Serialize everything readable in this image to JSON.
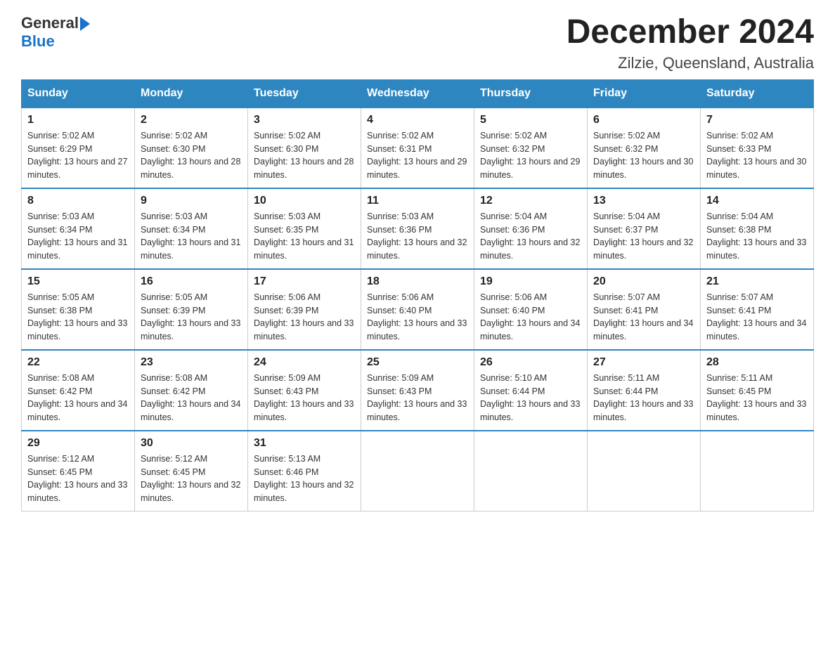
{
  "logo": {
    "general": "General",
    "blue": "Blue"
  },
  "title": "December 2024",
  "location": "Zilzie, Queensland, Australia",
  "days_of_week": [
    "Sunday",
    "Monday",
    "Tuesday",
    "Wednesday",
    "Thursday",
    "Friday",
    "Saturday"
  ],
  "weeks": [
    [
      {
        "day": "1",
        "sunrise": "5:02 AM",
        "sunset": "6:29 PM",
        "daylight": "13 hours and 27 minutes."
      },
      {
        "day": "2",
        "sunrise": "5:02 AM",
        "sunset": "6:30 PM",
        "daylight": "13 hours and 28 minutes."
      },
      {
        "day": "3",
        "sunrise": "5:02 AM",
        "sunset": "6:30 PM",
        "daylight": "13 hours and 28 minutes."
      },
      {
        "day": "4",
        "sunrise": "5:02 AM",
        "sunset": "6:31 PM",
        "daylight": "13 hours and 29 minutes."
      },
      {
        "day": "5",
        "sunrise": "5:02 AM",
        "sunset": "6:32 PM",
        "daylight": "13 hours and 29 minutes."
      },
      {
        "day": "6",
        "sunrise": "5:02 AM",
        "sunset": "6:32 PM",
        "daylight": "13 hours and 30 minutes."
      },
      {
        "day": "7",
        "sunrise": "5:02 AM",
        "sunset": "6:33 PM",
        "daylight": "13 hours and 30 minutes."
      }
    ],
    [
      {
        "day": "8",
        "sunrise": "5:03 AM",
        "sunset": "6:34 PM",
        "daylight": "13 hours and 31 minutes."
      },
      {
        "day": "9",
        "sunrise": "5:03 AM",
        "sunset": "6:34 PM",
        "daylight": "13 hours and 31 minutes."
      },
      {
        "day": "10",
        "sunrise": "5:03 AM",
        "sunset": "6:35 PM",
        "daylight": "13 hours and 31 minutes."
      },
      {
        "day": "11",
        "sunrise": "5:03 AM",
        "sunset": "6:36 PM",
        "daylight": "13 hours and 32 minutes."
      },
      {
        "day": "12",
        "sunrise": "5:04 AM",
        "sunset": "6:36 PM",
        "daylight": "13 hours and 32 minutes."
      },
      {
        "day": "13",
        "sunrise": "5:04 AM",
        "sunset": "6:37 PM",
        "daylight": "13 hours and 32 minutes."
      },
      {
        "day": "14",
        "sunrise": "5:04 AM",
        "sunset": "6:38 PM",
        "daylight": "13 hours and 33 minutes."
      }
    ],
    [
      {
        "day": "15",
        "sunrise": "5:05 AM",
        "sunset": "6:38 PM",
        "daylight": "13 hours and 33 minutes."
      },
      {
        "day": "16",
        "sunrise": "5:05 AM",
        "sunset": "6:39 PM",
        "daylight": "13 hours and 33 minutes."
      },
      {
        "day": "17",
        "sunrise": "5:06 AM",
        "sunset": "6:39 PM",
        "daylight": "13 hours and 33 minutes."
      },
      {
        "day": "18",
        "sunrise": "5:06 AM",
        "sunset": "6:40 PM",
        "daylight": "13 hours and 33 minutes."
      },
      {
        "day": "19",
        "sunrise": "5:06 AM",
        "sunset": "6:40 PM",
        "daylight": "13 hours and 34 minutes."
      },
      {
        "day": "20",
        "sunrise": "5:07 AM",
        "sunset": "6:41 PM",
        "daylight": "13 hours and 34 minutes."
      },
      {
        "day": "21",
        "sunrise": "5:07 AM",
        "sunset": "6:41 PM",
        "daylight": "13 hours and 34 minutes."
      }
    ],
    [
      {
        "day": "22",
        "sunrise": "5:08 AM",
        "sunset": "6:42 PM",
        "daylight": "13 hours and 34 minutes."
      },
      {
        "day": "23",
        "sunrise": "5:08 AM",
        "sunset": "6:42 PM",
        "daylight": "13 hours and 34 minutes."
      },
      {
        "day": "24",
        "sunrise": "5:09 AM",
        "sunset": "6:43 PM",
        "daylight": "13 hours and 33 minutes."
      },
      {
        "day": "25",
        "sunrise": "5:09 AM",
        "sunset": "6:43 PM",
        "daylight": "13 hours and 33 minutes."
      },
      {
        "day": "26",
        "sunrise": "5:10 AM",
        "sunset": "6:44 PM",
        "daylight": "13 hours and 33 minutes."
      },
      {
        "day": "27",
        "sunrise": "5:11 AM",
        "sunset": "6:44 PM",
        "daylight": "13 hours and 33 minutes."
      },
      {
        "day": "28",
        "sunrise": "5:11 AM",
        "sunset": "6:45 PM",
        "daylight": "13 hours and 33 minutes."
      }
    ],
    [
      {
        "day": "29",
        "sunrise": "5:12 AM",
        "sunset": "6:45 PM",
        "daylight": "13 hours and 33 minutes."
      },
      {
        "day": "30",
        "sunrise": "5:12 AM",
        "sunset": "6:45 PM",
        "daylight": "13 hours and 32 minutes."
      },
      {
        "day": "31",
        "sunrise": "5:13 AM",
        "sunset": "6:46 PM",
        "daylight": "13 hours and 32 minutes."
      },
      null,
      null,
      null,
      null
    ]
  ]
}
